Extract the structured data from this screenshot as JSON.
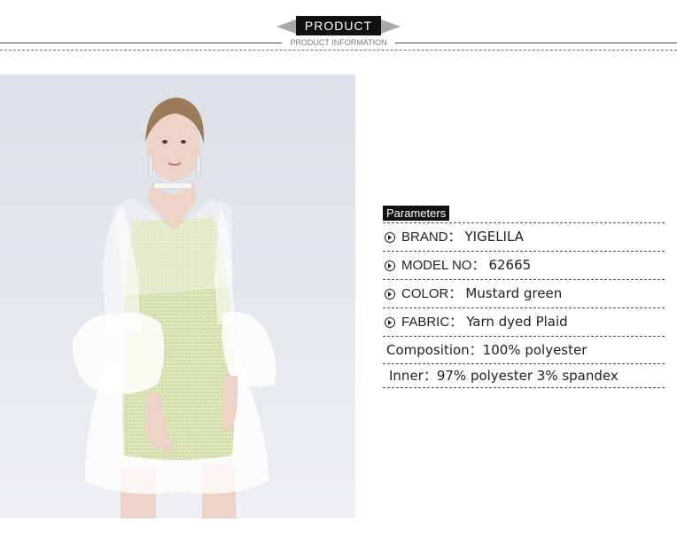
{
  "header": {
    "title": "PRODUCT",
    "subtitle": "PRODUCT INFORMATION"
  },
  "parameters": {
    "heading": "Parameters",
    "rows": [
      {
        "icon": "arrow-circle-icon",
        "label": "BRAND：",
        "value": "YIGELILA"
      },
      {
        "icon": "arrow-circle-icon",
        "label": "MODEL NO：",
        "value": "62665"
      },
      {
        "icon": "arrow-circle-icon",
        "label": "COLOR：",
        "value": "Mustard green"
      },
      {
        "icon": "arrow-circle-icon",
        "label": "FABRIC：",
        "value": "Yarn dyed Plaid"
      }
    ],
    "composition": "Composition：100% polyester",
    "inner": "Inner：97% polyester 3% spandex"
  },
  "colors": {
    "background": "#ffffff",
    "title_box": "#111111",
    "wing": "#a9a9a9",
    "dress": "#d7e2b5",
    "organza": "#ffffff"
  }
}
